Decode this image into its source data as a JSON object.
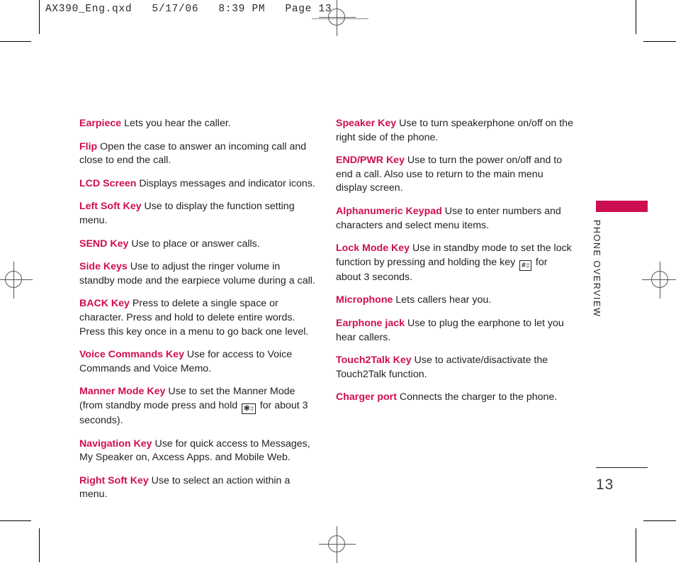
{
  "prepress": {
    "slug": "AX390_Eng.qxd   5/17/06   8:39 PM   Page 13"
  },
  "sidebar": {
    "running_head": "PHONE OVERVIEW",
    "accent_color": "#ce0e53"
  },
  "folio": {
    "page_number": "13"
  },
  "columns": {
    "left": [
      {
        "term": "Earpiece",
        "desc": " Lets you hear the caller."
      },
      {
        "term": "Flip",
        "desc": " Open the case to answer an incoming call and close to end the call."
      },
      {
        "term": "LCD Screen",
        "desc": " Displays messages and indicator icons."
      },
      {
        "term": "Left Soft Key",
        "desc": " Use to display the function setting menu."
      },
      {
        "term": "SEND Key",
        "desc": " Use to place or answer calls."
      },
      {
        "term": "Side Keys",
        "desc": " Use to adjust the ringer volume in standby mode and the earpiece volume during a call."
      },
      {
        "term": "BACK Key",
        "desc": " Press to delete a single space or character. Press and hold to delete entire words. Press this key once in a menu to go back one level."
      },
      {
        "term": "Voice Commands Key",
        "desc": " Use for access to Voice Commands and Voice Memo."
      },
      {
        "term": "Manner Mode Key",
        "desc_before": " Use to set the Manner Mode (from standby mode press and hold ",
        "key_icon": {
          "name": "star-key-icon",
          "big": "✻",
          "small": "▒"
        },
        "desc_after": " for about 3 seconds)."
      },
      {
        "term": "Navigation Key",
        "desc": " Use for quick access to Messages, My  Speaker on, Axcess Apps. and Mobile Web."
      },
      {
        "term": "Right Soft Key",
        "desc": " Use to select an action within a menu."
      }
    ],
    "right": [
      {
        "term": "Speaker Key",
        "desc": " Use to turn speakerphone on/off on the right side of the phone."
      },
      {
        "term": "END/PWR Key",
        "desc": " Use to turn the power on/off and to end a call. Also use to return to the main menu display screen."
      },
      {
        "term": "Alphanumeric Keypad",
        "desc": " Use to enter numbers and characters and select menu items."
      },
      {
        "term": "Lock Mode Key",
        "desc_before": " Use in standby mode to set the lock function by pressing and holding the key ",
        "key_icon": {
          "name": "pound-key-icon",
          "big": "#",
          "small": "▒"
        },
        "desc_after": " for about 3 seconds."
      },
      {
        "term": "Microphone",
        "desc": " Lets callers hear you."
      },
      {
        "term": "Earphone jack",
        "desc": " Use to plug the earphone to let you hear callers."
      },
      {
        "term": "Touch2Talk Key",
        "desc": " Use to activate/disactivate the Touch2Talk function."
      },
      {
        "term": "Charger port",
        "desc": " Connects the charger to the phone."
      }
    ]
  }
}
